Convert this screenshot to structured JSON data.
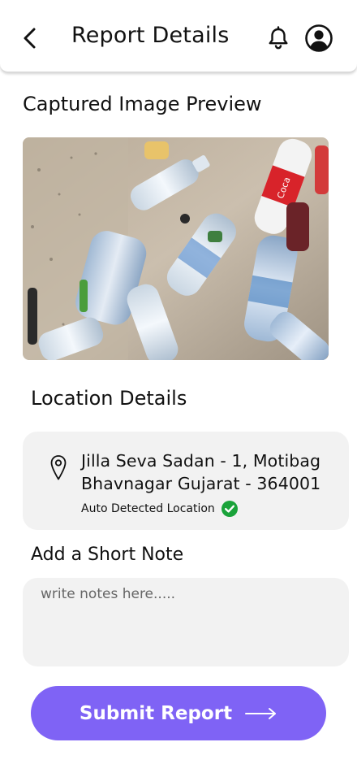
{
  "header": {
    "title": "Report Details",
    "back_icon": "chevron-left-icon",
    "notification_icon": "bell-icon",
    "profile_icon": "user-circle-icon"
  },
  "preview": {
    "title": "Captured Image Preview"
  },
  "location": {
    "title": "Location Details",
    "address_line1": "Jilla Seva Sadan - 1, Motibag",
    "address_line2": "Bhavnagar Gujarat - 364001",
    "auto_label": "Auto Detected Location",
    "pin_icon": "map-pin-icon",
    "verified_icon": "check-circle-icon"
  },
  "note": {
    "title": "Add a Short Note",
    "placeholder": "write notes here.....",
    "value": ""
  },
  "submit": {
    "label": "Submit Report",
    "arrow_icon": "arrow-right-icon"
  },
  "colors": {
    "accent": "#7f63f5",
    "card_bg": "#f2f2f2",
    "verified": "#1aa33a"
  }
}
